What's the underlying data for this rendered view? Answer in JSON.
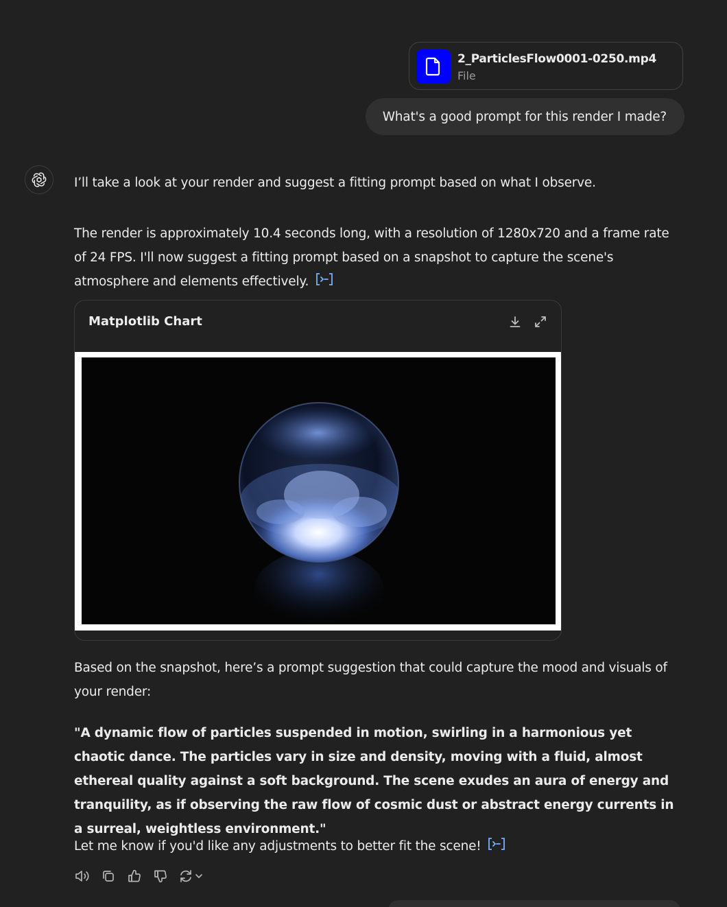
{
  "user": {
    "file": {
      "name": "2_ParticlesFlow0001-0250.mp4",
      "type_label": "File",
      "icon": "document-icon",
      "icon_bg": "#0000ff"
    },
    "message": "What's a good prompt for this render I made?"
  },
  "assistant": {
    "avatar_icon": "openai-logo-icon",
    "intro": "I’ll take a look at your render and suggest a fitting prompt based on what I observe.",
    "analysis": "The render is approximately 10.4 seconds long, with a resolution of 1280x720 and a frame rate of 24 FPS. I'll now suggest a fitting prompt based on a snapshot to capture the scene's atmosphere and elements effectively.",
    "chart_card": {
      "title": "Matplotlib Chart",
      "download_icon": "download-icon",
      "expand_icon": "expand-icon"
    },
    "suggestion_intro": "Based on the snapshot, here’s a prompt suggestion that could capture the mood and visuals of your render:",
    "prompt_quote": "\"A dynamic flow of particles suspended in motion, swirling in a harmonious yet chaotic dance. The particles vary in size and density, moving with a fluid, almost ethereal quality against a soft background. The scene exudes an aura of energy and tranquility, as if observing the raw flow of cosmic dust or abstract energy currents in a surreal, weightless environment.\"",
    "closing": "Let me know if you'd like any adjustments to better fit the scene!",
    "actions": [
      "read-aloud-icon",
      "copy-icon",
      "thumbs-up-icon",
      "thumbs-down-icon",
      "regenerate-icon"
    ]
  },
  "colors": {
    "background": "#212121",
    "user_bubble": "#303030",
    "link_accent": "#7ab1ff"
  }
}
